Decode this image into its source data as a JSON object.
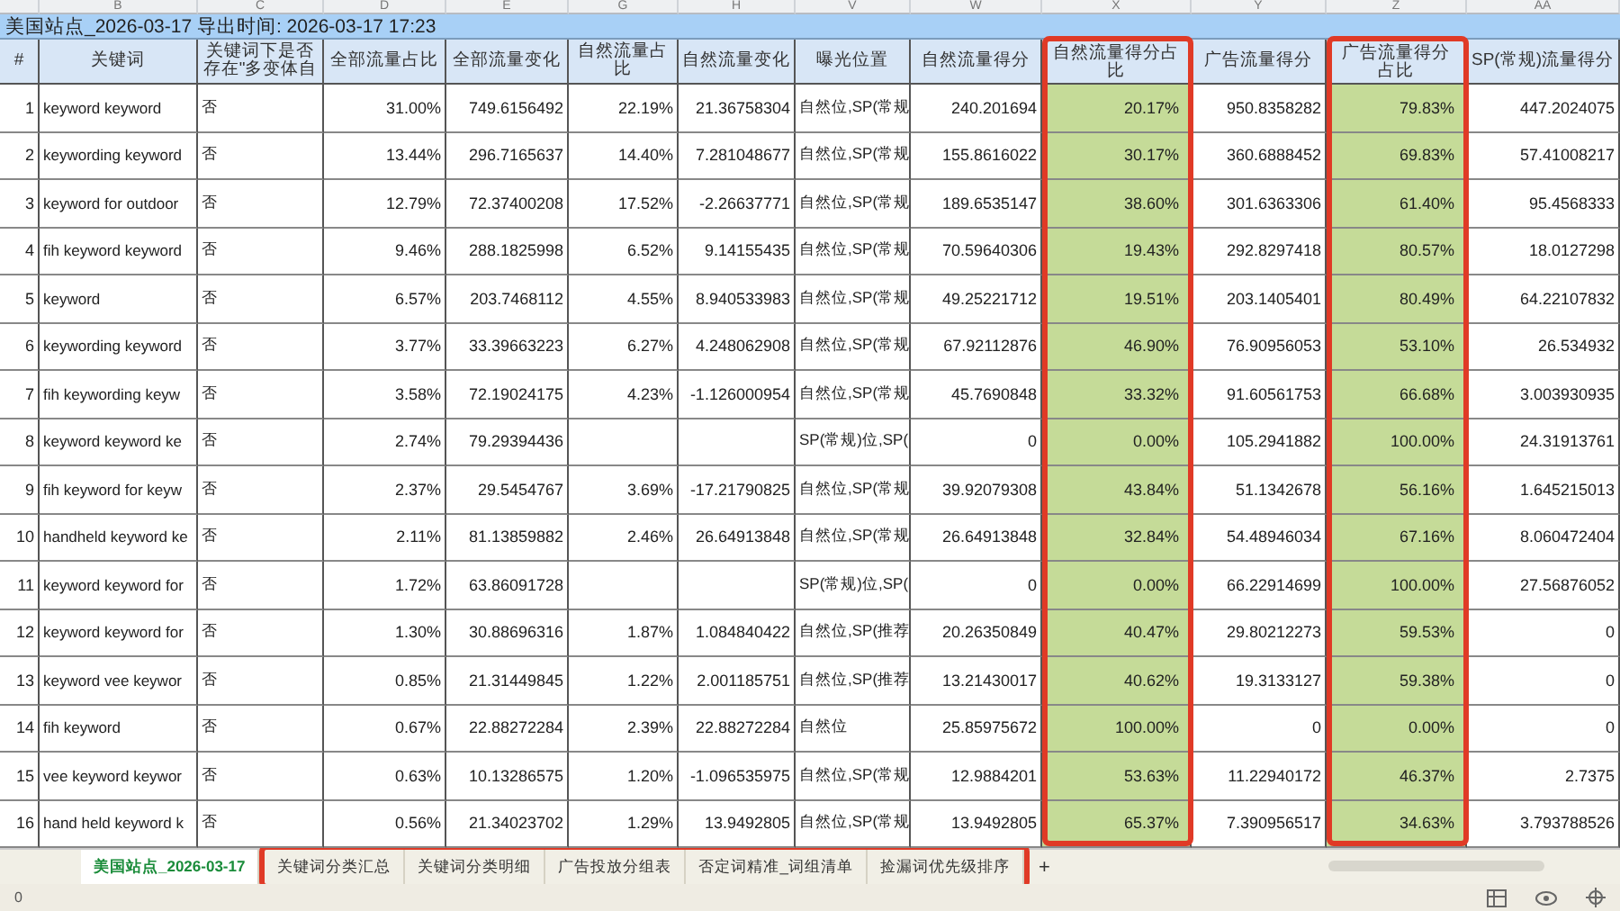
{
  "title": "美国站点_2026-03-17 导出时间: 2026-03-17 17:23",
  "columns": [
    {
      "header": "#",
      "kind": "number",
      "highlighted": false
    },
    {
      "letter": "B",
      "header": "关键词",
      "kind": "text",
      "highlighted": false
    },
    {
      "letter": "C",
      "header": "关键词下是否存在\"多变体自",
      "kind": "text",
      "highlighted": false
    },
    {
      "letter": "D",
      "header": "全部流量占比",
      "kind": "number",
      "highlighted": false
    },
    {
      "letter": "E",
      "header": "全部流量变化",
      "kind": "number",
      "highlighted": false
    },
    {
      "letter": "G",
      "header": "自然流量占比",
      "kind": "number",
      "highlighted": false
    },
    {
      "letter": "H",
      "header": "自然流量变化",
      "kind": "number",
      "highlighted": false
    },
    {
      "letter": "V",
      "header": "曝光位置",
      "kind": "text",
      "highlighted": false
    },
    {
      "letter": "W",
      "header": "自然流量得分",
      "kind": "number",
      "highlighted": false
    },
    {
      "letter": "X",
      "header": "自然流量得分占比",
      "kind": "number",
      "highlighted": true
    },
    {
      "letter": "Y",
      "header": "广告流量得分",
      "kind": "number",
      "highlighted": false
    },
    {
      "letter": "Z",
      "header": "广告流量得分占比",
      "kind": "number",
      "highlighted": true
    },
    {
      "letter": "AA",
      "header": "SP(常规)流量得分",
      "kind": "number",
      "highlighted": false
    }
  ],
  "rows": [
    [
      "1",
      "keyword keyword",
      "否",
      "31.00%",
      "749.6156492",
      "22.19%",
      "21.36758304",
      "自然位,SP(常规",
      "240.201694",
      "20.17%",
      "950.8358282",
      "79.83%",
      "447.2024075"
    ],
    [
      "2",
      "keywording keyword",
      "否",
      "13.44%",
      "296.7165637",
      "14.40%",
      "7.281048677",
      "自然位,SP(常规",
      "155.8616022",
      "30.17%",
      "360.6888452",
      "69.83%",
      "57.41008217"
    ],
    [
      "3",
      "keyword for outdoor",
      "否",
      "12.79%",
      "72.37400208",
      "17.52%",
      "-2.26637771",
      "自然位,SP(常规",
      "189.6535147",
      "38.60%",
      "301.6363306",
      "61.40%",
      "95.4568333"
    ],
    [
      "4",
      "fih keyword keyword",
      "否",
      "9.46%",
      "288.1825998",
      "6.52%",
      "9.14155435",
      "自然位,SP(常规",
      "70.59640306",
      "19.43%",
      "292.8297418",
      "80.57%",
      "18.0127298"
    ],
    [
      "5",
      "keyword",
      "否",
      "6.57%",
      "203.7468112",
      "4.55%",
      "8.940533983",
      "自然位,SP(常规",
      "49.25221712",
      "19.51%",
      "203.1405401",
      "80.49%",
      "64.22107832"
    ],
    [
      "6",
      "keywording keyword",
      "否",
      "3.77%",
      "33.39663223",
      "6.27%",
      "4.248062908",
      "自然位,SP(常规",
      "67.92112876",
      "46.90%",
      "76.90956053",
      "53.10%",
      "26.534932"
    ],
    [
      "7",
      "fih keywording keyw",
      "否",
      "3.58%",
      "72.19024175",
      "4.23%",
      "-1.126000954",
      "自然位,SP(常规",
      "45.7690848",
      "33.32%",
      "91.60561753",
      "66.68%",
      "3.003930935"
    ],
    [
      "8",
      "keyword keyword ke",
      "否",
      "2.74%",
      "79.29394436",
      null,
      null,
      "SP(常规)位,SP(",
      "0",
      "0.00%",
      "105.2941882",
      "100.00%",
      "24.31913761"
    ],
    [
      "9",
      "fih keyword for keyw",
      "否",
      "2.37%",
      "29.5454767",
      "3.69%",
      "-17.21790825",
      "自然位,SP(常规",
      "39.92079308",
      "43.84%",
      "51.1342678",
      "56.16%",
      "1.645215013"
    ],
    [
      "10",
      "handheld keyword ke",
      "否",
      "2.11%",
      "81.13859882",
      "2.46%",
      "26.64913848",
      "自然位,SP(常规",
      "26.64913848",
      "32.84%",
      "54.48946034",
      "67.16%",
      "8.060472404"
    ],
    [
      "11",
      "keyword keyword for",
      "否",
      "1.72%",
      "63.86091728",
      null,
      null,
      "SP(常规)位,SP(",
      "0",
      "0.00%",
      "66.22914699",
      "100.00%",
      "27.56876052"
    ],
    [
      "12",
      "keyword keyword for",
      "否",
      "1.30%",
      "30.88696316",
      "1.87%",
      "1.084840422",
      "自然位,SP(推荐",
      "20.26350849",
      "40.47%",
      "29.80212273",
      "59.53%",
      "0"
    ],
    [
      "13",
      "keyword vee keywor",
      "否",
      "0.85%",
      "21.31449845",
      "1.22%",
      "2.001185751",
      "自然位,SP(推荐",
      "13.21430017",
      "40.62%",
      "19.3133127",
      "59.38%",
      "0"
    ],
    [
      "14",
      "fih keyword",
      "否",
      "0.67%",
      "22.88272284",
      "2.39%",
      "22.88272284",
      "自然位",
      "25.85975672",
      "100.00%",
      "0",
      "0.00%",
      "0"
    ],
    [
      "15",
      "vee keyword keywor",
      "否",
      "0.63%",
      "10.13286575",
      "1.20%",
      "-1.096535975",
      "自然位,SP(常规",
      "12.9884201",
      "53.63%",
      "11.22940172",
      "46.37%",
      "2.7375"
    ],
    [
      "16",
      "hand held keyword k",
      "否",
      "0.56%",
      "21.34023702",
      "1.29%",
      "13.9492805",
      "自然位,SP(常规",
      "13.9492805",
      "65.37%",
      "7.390956517",
      "34.63%",
      "3.793788526"
    ]
  ],
  "sheet_tabs": {
    "tabs": [
      {
        "label": "美国站点_2026-03-17",
        "selected": true,
        "highlighted": false
      },
      {
        "label": "关键词分类汇总",
        "selected": false,
        "highlighted": true
      },
      {
        "label": "关键词分类明细",
        "selected": false,
        "highlighted": true
      },
      {
        "label": "广告投放分组表",
        "selected": false,
        "highlighted": true
      },
      {
        "label": "否定词精准_词组清单",
        "selected": false,
        "highlighted": true
      },
      {
        "label": "捡漏词优先级排序",
        "selected": false,
        "highlighted": true
      }
    ],
    "add_label": "+"
  },
  "status_bar": {
    "left_text": "0"
  }
}
